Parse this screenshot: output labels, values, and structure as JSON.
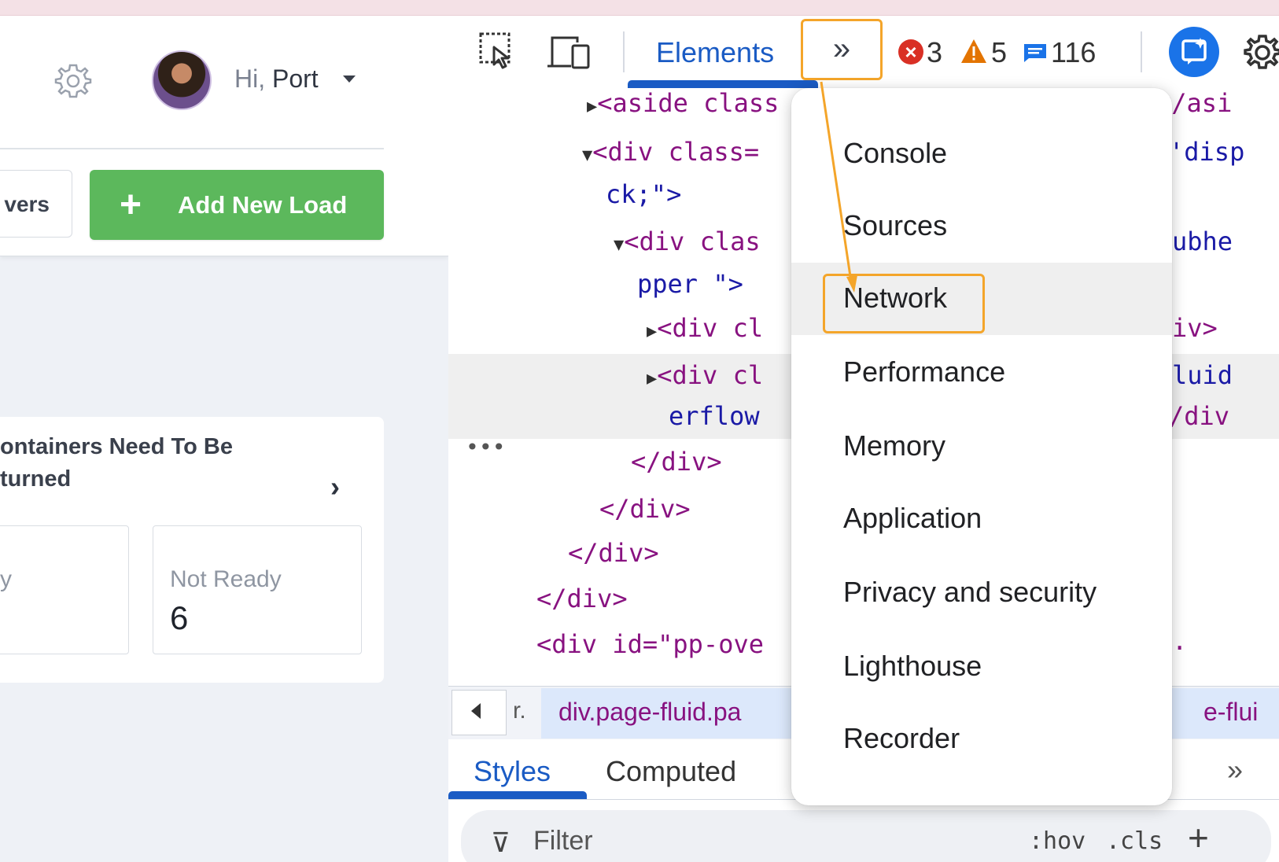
{
  "app": {
    "greeting_prefix": "Hi,",
    "greeting_name": "Port",
    "drivers_button_label": "vers",
    "add_load_label": "Add New Load",
    "add_load_icon": "+",
    "card": {
      "title_line1": "ontainers Need To Be",
      "title_line2": "turned",
      "chevron": "›",
      "stat1_label": "y",
      "stat2_label": "Not Ready",
      "stat2_value": "6"
    },
    "colors": {
      "add_button": "#5cb85c"
    }
  },
  "devtools": {
    "tabs": {
      "elements": "Elements",
      "more": "»"
    },
    "issues": {
      "errors": "3",
      "warnings": "5",
      "messages": "116"
    },
    "dom_lines": [
      "<aside class",
      "<div class=",
      "ck;\">",
      "<div clas",
      "pper \">",
      "<div cl",
      "<div cl",
      "erflow",
      "</div>",
      "</div>",
      "</div>",
      "</div>",
      "<div id=\"pp-ove"
    ],
    "dom_right": [
      "</asi",
      "'disp",
      "ubhe",
      "iv>",
      "luid",
      "/div",
      "."
    ],
    "dom_ellipsis": "•••",
    "breadcrumb": {
      "prev": "r.",
      "current": "div.page-fluid.pa",
      "next": "e-flui"
    },
    "styles_tabs": {
      "styles": "Styles",
      "computed": "Computed",
      "more": "»"
    },
    "filter": {
      "placeholder": "Filter",
      "hov": ":hov",
      "cls": ".cls",
      "add": "+"
    },
    "menu_items": [
      "Console",
      "Sources",
      "Network",
      "Performance",
      "Memory",
      "Application",
      "Privacy and security",
      "Lighthouse",
      "Recorder"
    ],
    "colors": {
      "accent": "#1a5bc4",
      "highlight": "#f4a52a",
      "error": "#d93025",
      "warning": "#e37400"
    }
  }
}
